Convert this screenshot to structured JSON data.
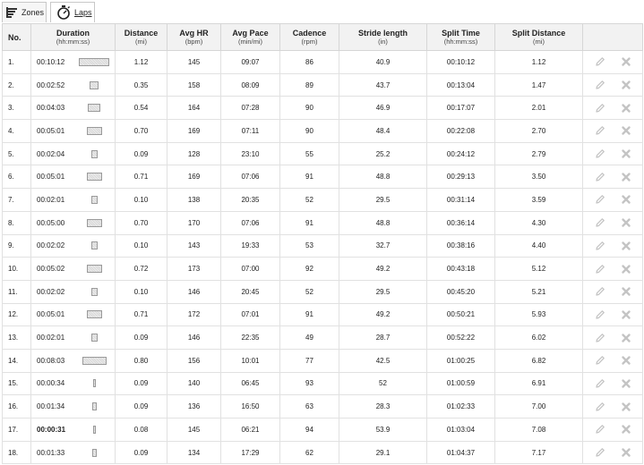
{
  "tabs": [
    {
      "label": "Zones",
      "icon": "bars-icon"
    },
    {
      "label": "Laps",
      "icon": "stopwatch-icon"
    }
  ],
  "columns": [
    {
      "label": "No.",
      "unit": ""
    },
    {
      "label": "Duration",
      "unit": "(hh:mm:ss)"
    },
    {
      "label": "Distance",
      "unit": "(mi)"
    },
    {
      "label": "Avg HR",
      "unit": "(bpm)"
    },
    {
      "label": "Avg Pace",
      "unit": "(min/mi)"
    },
    {
      "label": "Cadence",
      "unit": "(rpm)"
    },
    {
      "label": "Stride length",
      "unit": "(in)"
    },
    {
      "label": "Split Time",
      "unit": "(hh:mm:ss)"
    },
    {
      "label": "Split Distance",
      "unit": "(mi)"
    },
    {
      "label": "",
      "unit": ""
    }
  ],
  "colors": {
    "bar_fill": "#d8d8d8",
    "bar_border": "#9a9a9a",
    "header_bg": "#f2f2f2",
    "grid": "#e1e1e1",
    "action_icon": "#c4c4c4"
  },
  "rows": [
    {
      "no": "1.",
      "duration": "00:10:12",
      "distance": "1.12",
      "avg_hr": "145",
      "avg_pace": "09:07",
      "cadence": "86",
      "stride": "40.9",
      "split_time": "00:10:12",
      "split_distance": "1.12",
      "highlight": false
    },
    {
      "no": "2.",
      "duration": "00:02:52",
      "distance": "0.35",
      "avg_hr": "158",
      "avg_pace": "08:09",
      "cadence": "89",
      "stride": "43.7",
      "split_time": "00:13:04",
      "split_distance": "1.47",
      "highlight": false
    },
    {
      "no": "3.",
      "duration": "00:04:03",
      "distance": "0.54",
      "avg_hr": "164",
      "avg_pace": "07:28",
      "cadence": "90",
      "stride": "46.9",
      "split_time": "00:17:07",
      "split_distance": "2.01",
      "highlight": false
    },
    {
      "no": "4.",
      "duration": "00:05:01",
      "distance": "0.70",
      "avg_hr": "169",
      "avg_pace": "07:11",
      "cadence": "90",
      "stride": "48.4",
      "split_time": "00:22:08",
      "split_distance": "2.70",
      "highlight": false
    },
    {
      "no": "5.",
      "duration": "00:02:04",
      "distance": "0.09",
      "avg_hr": "128",
      "avg_pace": "23:10",
      "cadence": "55",
      "stride": "25.2",
      "split_time": "00:24:12",
      "split_distance": "2.79",
      "highlight": false
    },
    {
      "no": "6.",
      "duration": "00:05:01",
      "distance": "0.71",
      "avg_hr": "169",
      "avg_pace": "07:06",
      "cadence": "91",
      "stride": "48.8",
      "split_time": "00:29:13",
      "split_distance": "3.50",
      "highlight": false
    },
    {
      "no": "7.",
      "duration": "00:02:01",
      "distance": "0.10",
      "avg_hr": "138",
      "avg_pace": "20:35",
      "cadence": "52",
      "stride": "29.5",
      "split_time": "00:31:14",
      "split_distance": "3.59",
      "highlight": false
    },
    {
      "no": "8.",
      "duration": "00:05:00",
      "distance": "0.70",
      "avg_hr": "170",
      "avg_pace": "07:06",
      "cadence": "91",
      "stride": "48.8",
      "split_time": "00:36:14",
      "split_distance": "4.30",
      "highlight": false
    },
    {
      "no": "9.",
      "duration": "00:02:02",
      "distance": "0.10",
      "avg_hr": "143",
      "avg_pace": "19:33",
      "cadence": "53",
      "stride": "32.7",
      "split_time": "00:38:16",
      "split_distance": "4.40",
      "highlight": false
    },
    {
      "no": "10.",
      "duration": "00:05:02",
      "distance": "0.72",
      "avg_hr": "173",
      "avg_pace": "07:00",
      "cadence": "92",
      "stride": "49.2",
      "split_time": "00:43:18",
      "split_distance": "5.12",
      "highlight": false
    },
    {
      "no": "11.",
      "duration": "00:02:02",
      "distance": "0.10",
      "avg_hr": "146",
      "avg_pace": "20:45",
      "cadence": "52",
      "stride": "29.5",
      "split_time": "00:45:20",
      "split_distance": "5.21",
      "highlight": false
    },
    {
      "no": "12.",
      "duration": "00:05:01",
      "distance": "0.71",
      "avg_hr": "172",
      "avg_pace": "07:01",
      "cadence": "91",
      "stride": "49.2",
      "split_time": "00:50:21",
      "split_distance": "5.93",
      "highlight": false
    },
    {
      "no": "13.",
      "duration": "00:02:01",
      "distance": "0.09",
      "avg_hr": "146",
      "avg_pace": "22:35",
      "cadence": "49",
      "stride": "28.7",
      "split_time": "00:52:22",
      "split_distance": "6.02",
      "highlight": false
    },
    {
      "no": "14.",
      "duration": "00:08:03",
      "distance": "0.80",
      "avg_hr": "156",
      "avg_pace": "10:01",
      "cadence": "77",
      "stride": "42.5",
      "split_time": "01:00:25",
      "split_distance": "6.82",
      "highlight": false
    },
    {
      "no": "15.",
      "duration": "00:00:34",
      "distance": "0.09",
      "avg_hr": "140",
      "avg_pace": "06:45",
      "cadence": "93",
      "stride": "52",
      "split_time": "01:00:59",
      "split_distance": "6.91",
      "highlight": false
    },
    {
      "no": "16.",
      "duration": "00:01:34",
      "distance": "0.09",
      "avg_hr": "136",
      "avg_pace": "16:50",
      "cadence": "63",
      "stride": "28.3",
      "split_time": "01:02:33",
      "split_distance": "7.00",
      "highlight": false
    },
    {
      "no": "17.",
      "duration": "00:00:31",
      "distance": "0.08",
      "avg_hr": "145",
      "avg_pace": "06:21",
      "cadence": "94",
      "stride": "53.9",
      "split_time": "01:03:04",
      "split_distance": "7.08",
      "highlight": true
    },
    {
      "no": "18.",
      "duration": "00:01:33",
      "distance": "0.09",
      "avg_hr": "134",
      "avg_pace": "17:29",
      "cadence": "62",
      "stride": "29.1",
      "split_time": "01:04:37",
      "split_distance": "7.17",
      "highlight": false
    }
  ]
}
